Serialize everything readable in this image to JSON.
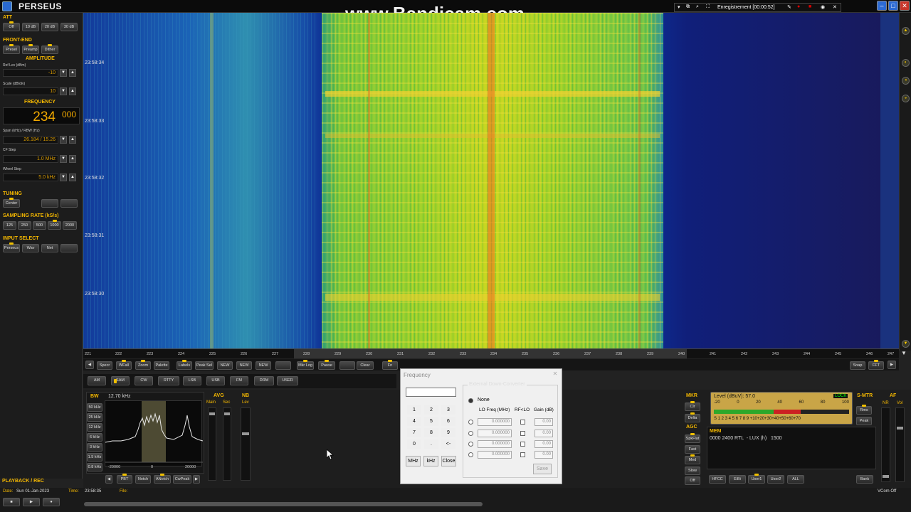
{
  "app": {
    "title": "PERSEUS"
  },
  "watermark": "www.Bandicam.com",
  "recorder": {
    "label": "Enregistrement [00:00:52]"
  },
  "left": {
    "att": {
      "title": "ATT",
      "buttons": [
        "Off",
        "10 dB",
        "20 dB",
        "30 dB"
      ]
    },
    "frontend": {
      "title": "FRONT-END",
      "buttons": [
        "Presel",
        "Preamp",
        "Dither"
      ]
    },
    "amplitude": {
      "title": "AMPLITUDE",
      "ref_label": "Ref Lev (dBm)",
      "ref_value": "-10",
      "scale_label": "Scale (dB/div)",
      "scale_value": "10"
    },
    "frequency": {
      "title": "FREQUENCY",
      "main": "234",
      "fraction": "000",
      "span_label": "Span (kHz) / RBW (Hz)",
      "span_value": "26.184 / 15.26",
      "cfstep_label": "CF Step",
      "cfstep_value": "1.0 MHz",
      "wheel_label": "Wheel Step",
      "wheel_value": "5.0 kHz"
    },
    "tuning": {
      "title": "TUNING",
      "buttons": [
        "Center",
        "",
        ""
      ]
    },
    "sampling": {
      "title": "SAMPLING RATE (kS/s)",
      "buttons": [
        "125",
        "250",
        "500",
        "1000",
        "2000"
      ]
    },
    "input": {
      "title": "INPUT SELECT",
      "buttons": [
        "Perseus",
        "Wav",
        "Net",
        ""
      ]
    }
  },
  "waterfall": {
    "times": [
      "23:58:34",
      "23:58:33",
      "23:58:32",
      "23:58:31",
      "23:58:30"
    ]
  },
  "axis": {
    "ticks": [
      "221",
      "222",
      "223",
      "224",
      "225",
      "226",
      "227",
      "228",
      "229",
      "230",
      "231",
      "232",
      "233",
      "234",
      "235",
      "236",
      "237",
      "238",
      "239",
      "240",
      "241",
      "242",
      "243",
      "244",
      "245",
      "246",
      "247"
    ]
  },
  "toolbar1": {
    "buttons": [
      "Specr",
      "WFall",
      "Zoom",
      "Palette",
      "Labels",
      "Peak Sel",
      "NEW",
      "NEW",
      "NEW",
      "",
      "Mkr Log",
      "Pause",
      "",
      "Clear",
      "",
      "Fn"
    ],
    "right": [
      "Snap",
      "FFT"
    ]
  },
  "modes": {
    "buttons": [
      "AM",
      "SAM",
      "CW",
      "RTTY",
      "LSB",
      "USB",
      "FM",
      "DRM",
      "USER"
    ]
  },
  "bw": {
    "title": "BW",
    "value": "12.70 kHz",
    "buttons": [
      "50 kHz",
      "25 kHz",
      "12 kHz",
      "6 kHz",
      "3 kHz",
      "1.5 kHz",
      "0.8 kHz"
    ],
    "xlabels": [
      "-20000",
      "0",
      "20000"
    ],
    "bottom_buttons": [
      "PBT",
      "Notch",
      "ANotch",
      "CwPeak"
    ]
  },
  "avg": {
    "title": "AVG",
    "main": "Main",
    "sec": "Sec"
  },
  "nb": {
    "title": "NB",
    "lev": "Lev"
  },
  "mkr": {
    "title": "MKR",
    "buttons": [
      "Clr",
      "Delta"
    ]
  },
  "agc": {
    "title": "AGC",
    "buttons": [
      "SpkFlat",
      "Fast",
      "Med",
      "Slow",
      "Off"
    ]
  },
  "smeter": {
    "level": "Level (dBuV): 57.0",
    "lock": "LOCK",
    "scale": [
      "-20",
      "0",
      "20",
      "40",
      "60",
      "80",
      "100"
    ],
    "sscale": "S 1 2 3 4 5 6 7 8 9 +10+20+30+40+50+60+70",
    "title": "S-MTR",
    "buttons": [
      "Rms",
      "Peak"
    ]
  },
  "af": {
    "title": "AF",
    "nr": "NR",
    "vol": "Vol"
  },
  "mem": {
    "title": "MEM",
    "entry": "0000 2400 RTL  - LUX (h)   1500",
    "buttons": [
      "HFCC",
      "EiBi",
      "User1",
      "User2",
      "ALL"
    ],
    "bank": "Bank"
  },
  "dialog": {
    "title": "Frequency",
    "keys": [
      "1",
      "2",
      "3",
      "4",
      "5",
      "6",
      "7",
      "8",
      "9",
      "0",
      ".",
      "<-"
    ],
    "buttons": [
      "MHz",
      "kHz",
      "Close"
    ],
    "group_title": "External Down-Converter",
    "none_label": "None",
    "col_lo": "LO Freq (MHz)",
    "col_rf": "RF<LO",
    "col_gain": "Gain (dB)",
    "rows": [
      [
        "0.000000",
        "0.00"
      ],
      [
        "0.000000",
        "0.00"
      ],
      [
        "0.000000",
        "0.00"
      ],
      [
        "0.000000",
        "0.00"
      ]
    ],
    "save": "Save"
  },
  "status": {
    "section": "PLAYBACK / REC",
    "date_label": "Date:",
    "date": "Sun 01-Jan-2023",
    "time_label": "Time:",
    "time": "23:58:35",
    "file_label": "File:",
    "vcom": "VCom Off"
  }
}
